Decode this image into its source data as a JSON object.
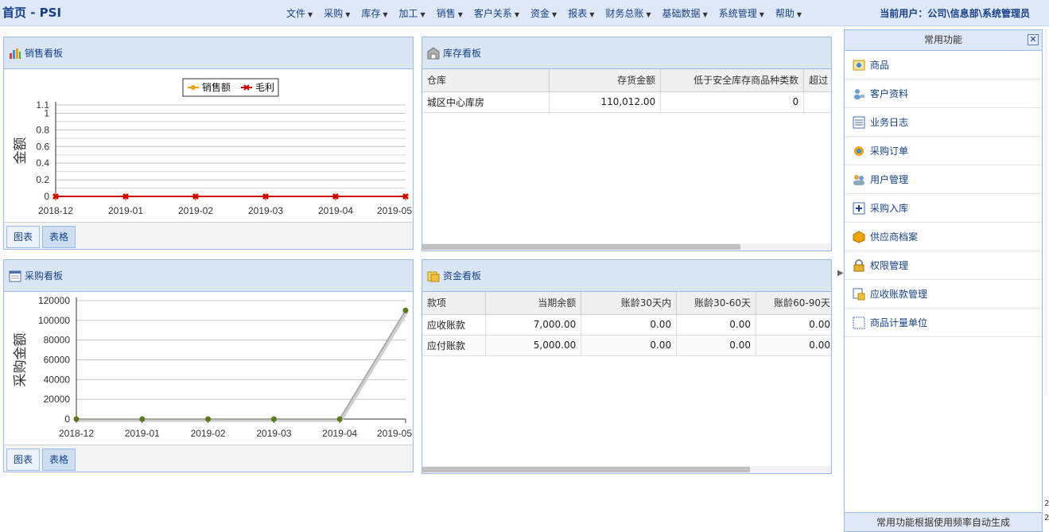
{
  "header": {
    "title": "首页 - PSI",
    "menu": [
      "文件",
      "采购",
      "库存",
      "加工",
      "销售",
      "客户关系",
      "资金",
      "报表",
      "财务总账",
      "基础数据",
      "系统管理",
      "帮助"
    ],
    "current_user": "当前用户：公司\\信息部\\系统管理员"
  },
  "sales_panel": {
    "title": "销售看板",
    "tabs": [
      "图表",
      "表格"
    ],
    "chart_data": {
      "type": "line",
      "categories": [
        "2018-12",
        "2019-01",
        "2019-02",
        "2019-03",
        "2019-04",
        "2019-05"
      ],
      "ylabel": "金额",
      "ylim": [
        0,
        1.1
      ],
      "yticks": [
        "0",
        "0.2",
        "0.4",
        "0.6",
        "0.8",
        "1",
        "1.1"
      ],
      "legend_position": "top",
      "series": [
        {
          "name": "销售额",
          "values": [
            0,
            0,
            0,
            0,
            0,
            0
          ],
          "color": "#f0a30a"
        },
        {
          "name": "毛利",
          "values": [
            0,
            0,
            0,
            0,
            0,
            0
          ],
          "color": "#cc0000"
        }
      ]
    }
  },
  "inventory_panel": {
    "title": "库存看板",
    "columns": [
      "仓库",
      "存货金额",
      "低于安全库存商品种类数",
      "超过"
    ],
    "rows": [
      [
        "城区中心库房",
        "110,012.00",
        "0",
        ""
      ]
    ]
  },
  "purchase_panel": {
    "title": "采购看板",
    "tabs": [
      "图表",
      "表格"
    ],
    "chart_data": {
      "type": "line",
      "categories": [
        "2018-12",
        "2019-01",
        "2019-02",
        "2019-03",
        "2019-04",
        "2019-05"
      ],
      "ylabel": "采购金额",
      "ylim": [
        0,
        120000
      ],
      "yticks": [
        "0",
        "20000",
        "40000",
        "60000",
        "80000",
        "100000",
        "120000"
      ],
      "series": [
        {
          "values": [
            0,
            0,
            0,
            0,
            0,
            110012
          ],
          "color": "#5a7a1a"
        }
      ]
    }
  },
  "funds_panel": {
    "title": "资金看板",
    "columns": [
      "款项",
      "当期余额",
      "账龄30天内",
      "账龄30-60天",
      "账龄60-90天"
    ],
    "rows": [
      [
        "应收账款",
        "7,000.00",
        "0.00",
        "0.00",
        "0.00"
      ],
      [
        "应付账款",
        "5,000.00",
        "0.00",
        "0.00",
        "0.00"
      ]
    ]
  },
  "favorites": {
    "title": "常用功能",
    "items": [
      {
        "label": "商品",
        "icon": "goods-icon"
      },
      {
        "label": "客户资料",
        "icon": "customer-icon"
      },
      {
        "label": "业务日志",
        "icon": "log-icon"
      },
      {
        "label": "采购订单",
        "icon": "purchase-order-icon"
      },
      {
        "label": "用户管理",
        "icon": "users-icon"
      },
      {
        "label": "采购入库",
        "icon": "inbound-icon"
      },
      {
        "label": "供应商档案",
        "icon": "supplier-icon"
      },
      {
        "label": "权限管理",
        "icon": "lock-icon"
      },
      {
        "label": "应收账款管理",
        "icon": "receivable-icon"
      },
      {
        "label": "商品计量单位",
        "icon": "unit-icon"
      }
    ],
    "footer": "常用功能根据使用频率自动生成"
  },
  "corner_digits": [
    "2",
    "2"
  ]
}
